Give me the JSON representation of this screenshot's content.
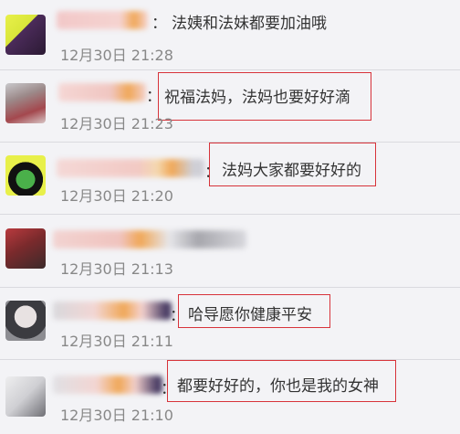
{
  "comments": [
    {
      "text": "法姨和法妹都要加油哦",
      "time": "12月30日 21:28"
    },
    {
      "text": "祝福法妈，法妈也要好好滴",
      "time": "12月30日 21:23"
    },
    {
      "text": "法妈大家都要好好的",
      "time": "12月30日 21:20"
    },
    {
      "text": "",
      "time": "12月30日 21:13"
    },
    {
      "text": "哈导愿你健康平安",
      "time": "12月30日 21:11"
    },
    {
      "text": "都要好好的，你也是我的女神",
      "time": "12月30日 21:10"
    }
  ],
  "colors": {
    "highlight_box": "#d7333a",
    "background": "#f3f3f6",
    "timestamp": "#888888"
  }
}
